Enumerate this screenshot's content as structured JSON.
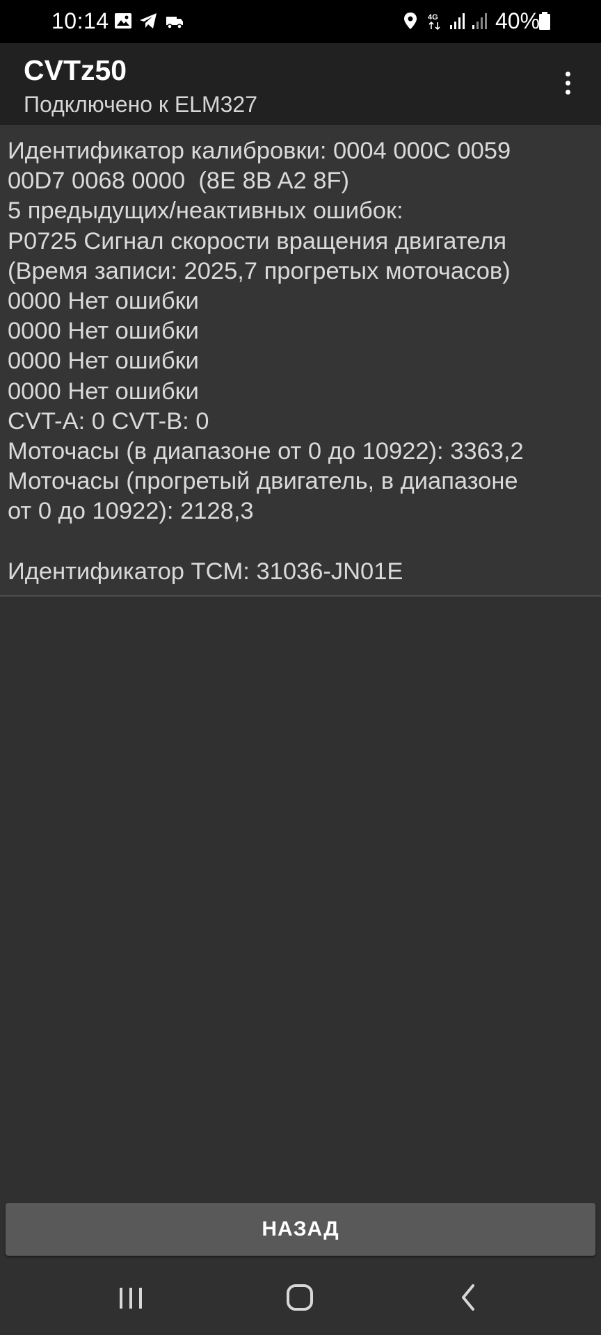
{
  "status_bar": {
    "time": "10:14",
    "battery": "40%",
    "network": "4G",
    "left_icons": [
      "gallery-icon",
      "telegram-icon",
      "truck-icon"
    ],
    "right_icons": [
      "location-icon",
      "network-4g-icon",
      "signal-icon",
      "signal-weak-icon",
      "battery-icon"
    ]
  },
  "app_bar": {
    "title": "CVTz50",
    "subtitle": "Подключено к ELM327",
    "menu_icon": "more-vert-icon"
  },
  "content": {
    "text": "Идентификатор калибровки: 0004 000C 0059\n00D7 0068 0000  (8E 8B A2 8F)\n5 предыдущих/неактивных ошибок:\nP0725 Сигнал скорости вращения двигателя\n(Время записи: 2025,7 прогретых моточасов)\n0000 Нет ошибки\n0000 Нет ошибки\n0000 Нет ошибки\n0000 Нет ошибки\nCVT-A: 0 CVT-B: 0\nМоточасы (в диапазоне от 0 до 10922): 3363,2\nМоточасы (прогретый двигатель, в диапазоне\nот 0 до 10922): 2128,3\n\nИдентификатор TCM: 31036-JN01E"
  },
  "back_button": {
    "label": "НАЗАД"
  },
  "nav_bar": {
    "recents": "recents-icon",
    "home": "home-icon",
    "back": "back-icon"
  },
  "colors": {
    "background": "#303030",
    "content_background": "#353535",
    "app_bar": "#212121",
    "button": "#595959",
    "status_bar": "#000000"
  }
}
